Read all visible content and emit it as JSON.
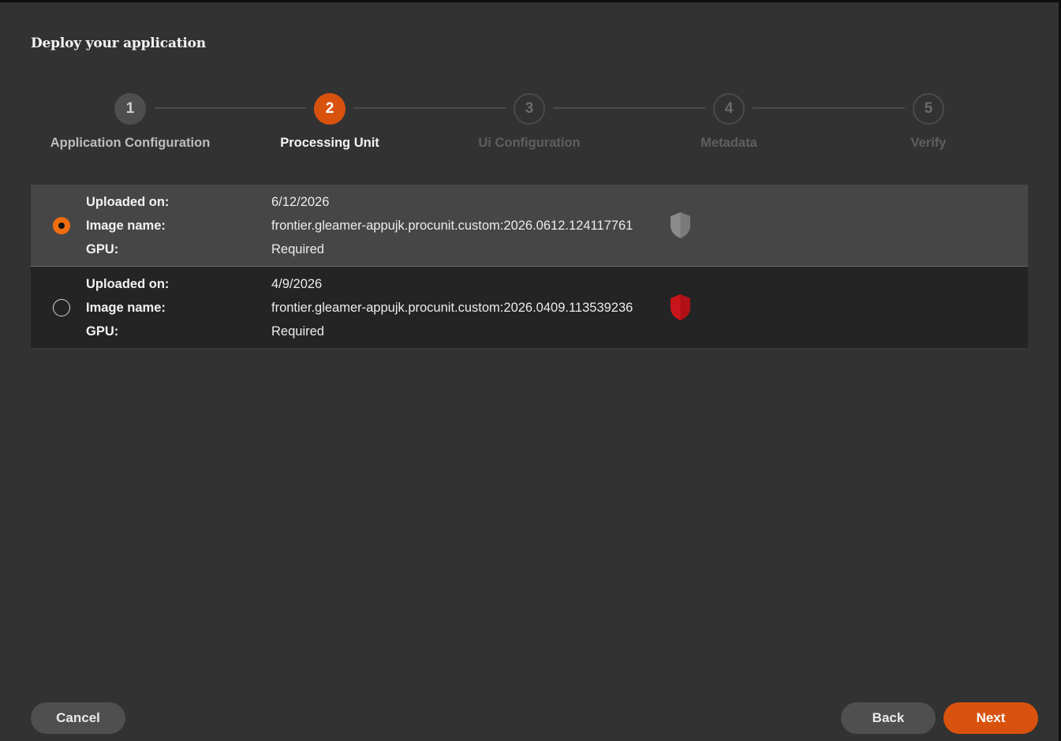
{
  "dialog": {
    "title": "Deploy your application"
  },
  "stepper": {
    "steps": [
      {
        "number": "1",
        "label": "Application Configuration",
        "state": "done"
      },
      {
        "number": "2",
        "label": "Processing Unit",
        "state": "active"
      },
      {
        "number": "3",
        "label": "Ui Configuration",
        "state": "todo"
      },
      {
        "number": "4",
        "label": "Metadata",
        "state": "todo"
      },
      {
        "number": "5",
        "label": "Verify",
        "state": "todo"
      }
    ]
  },
  "processing_units": {
    "field_labels": {
      "uploaded_on": "Uploaded on:",
      "image_name": "Image name:",
      "gpu": "GPU:"
    },
    "items": [
      {
        "selected": true,
        "uploaded_on": "6/12/2026",
        "image_name": "frontier.gleamer-appujk.procunit.custom:2026.0612.124117761",
        "gpu": "Required",
        "shield_icon": "shield-neutral-icon",
        "shield_color": "#8a8a8a"
      },
      {
        "selected": false,
        "uploaded_on": "4/9/2026",
        "image_name": "frontier.gleamer-appujk.procunit.custom:2026.0409.113539236",
        "gpu": "Required",
        "shield_icon": "shield-alert-icon",
        "shield_color": "#c8141a"
      }
    ]
  },
  "footer": {
    "cancel_label": "Cancel",
    "back_label": "Back",
    "next_label": "Next"
  },
  "colors": {
    "accent": "#d9520d",
    "radio_selected": "#f06d0f",
    "background": "#323232"
  }
}
